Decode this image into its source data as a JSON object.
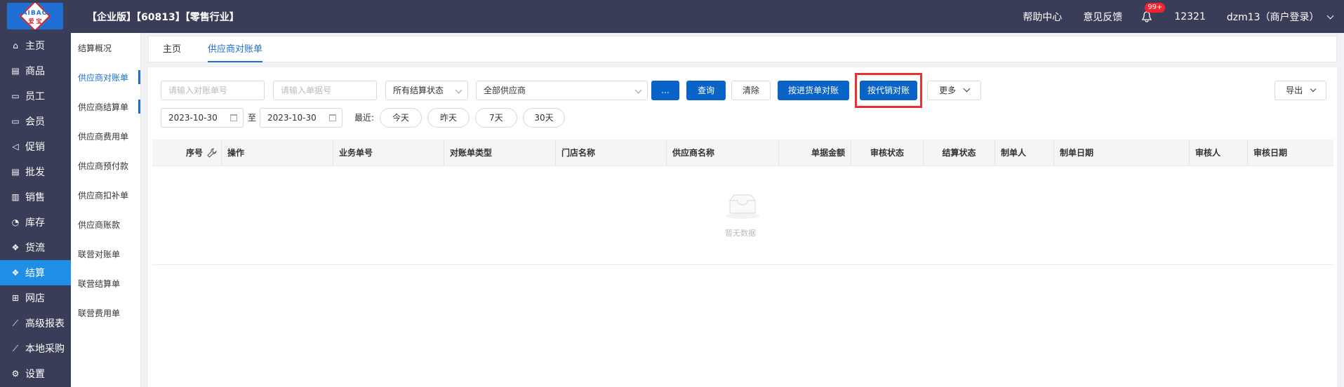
{
  "topbar": {
    "logo_text": "AIBAO",
    "logo_sub": "爱 宝",
    "title": "【企业版】【60813】【零售行业】",
    "help": "帮助中心",
    "feedback": "意见反馈",
    "notif_badge": "99+",
    "account_id": "12321",
    "user": "dzm13（商户登录）"
  },
  "sidebar": {
    "items": [
      {
        "label": "主页",
        "icon": "home-icon"
      },
      {
        "label": "商品",
        "icon": "goods-icon"
      },
      {
        "label": "员工",
        "icon": "staff-icon"
      },
      {
        "label": "会员",
        "icon": "member-icon"
      },
      {
        "label": "促销",
        "icon": "promo-icon"
      },
      {
        "label": "批发",
        "icon": "wholesale-icon"
      },
      {
        "label": "销售",
        "icon": "chart-icon"
      },
      {
        "label": "库存",
        "icon": "pie-icon"
      },
      {
        "label": "货流",
        "icon": "flow-icon"
      },
      {
        "label": "结算",
        "icon": "settle-icon"
      },
      {
        "label": "网店",
        "icon": "gift-icon"
      },
      {
        "label": "高级报表",
        "icon": "line-chart-icon"
      },
      {
        "label": "本地采购",
        "icon": "line-chart-icon"
      },
      {
        "label": "设置",
        "icon": "gear-icon"
      }
    ],
    "active_index": 9
  },
  "submenu": {
    "items": [
      "结算概况",
      "供应商对账单",
      "供应商结算单",
      "供应商费用单",
      "供应商预付款",
      "供应商扣补单",
      "供应商账款",
      "联营对账单",
      "联营结算单",
      "联营费用单"
    ]
  },
  "tabs": [
    "主页",
    "供应商对账单"
  ],
  "filters": {
    "recon_no_placeholder": "请输入对账单号",
    "doc_no_placeholder": "请输入单据号",
    "settle_status": "所有结算状态",
    "supplier": "全部供应商",
    "more_dots": "...",
    "query": "查询",
    "clear": "清除",
    "by_purchase": "按进货单对账",
    "by_consign": "按代销对账",
    "more": "更多",
    "export": "导出",
    "date_from": "2023-10-30",
    "to_label": "至",
    "date_to": "2023-10-30",
    "recent_label": "最近:",
    "today": "今天",
    "yesterday": "昨天",
    "seven_days": "7天",
    "thirty_days": "30天"
  },
  "table": {
    "columns": [
      "序号",
      "操作",
      "业务单号",
      "对账单类型",
      "门店名称",
      "供应商名称",
      "单据金额",
      "审核状态",
      "结算状态",
      "制单人",
      "制单日期",
      "审核人",
      "审核日期"
    ],
    "empty_text": "暂无数据"
  },
  "colors": {
    "nav_bg": "#3a3d57",
    "active": "#1f8ee6",
    "primary": "#0a64c8",
    "highlight": "#e83232"
  }
}
